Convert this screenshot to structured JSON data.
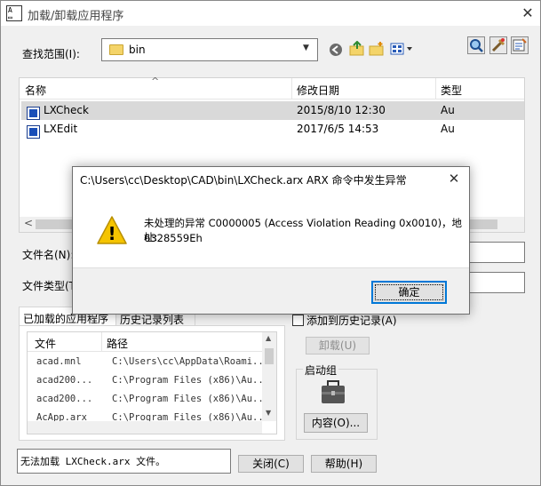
{
  "window": {
    "title": "加载/卸载应用程序",
    "app_icon_text": "A̲",
    "close_glyph": "✕"
  },
  "lookin": {
    "label": "查找范围(I):",
    "value": "bin"
  },
  "toolbar": {
    "right_icons": [
      "find-icon",
      "tools-icon",
      "options-icon"
    ]
  },
  "file_list": {
    "columns": [
      "名称",
      "修改日期",
      "类型"
    ],
    "sort_arrow": "^",
    "rows": [
      {
        "name": "LXCheck",
        "date": "2015/8/10 12:30",
        "type": "Au"
      },
      {
        "name": "LXEdit",
        "date": "2017/6/5 14:53",
        "type": "Au"
      }
    ],
    "hscroll_left": "<"
  },
  "filename": {
    "label": "文件名(N):"
  },
  "filetype": {
    "label": "文件类型(T)"
  },
  "tabs": {
    "loaded": "已加载的应用程序",
    "history": "历史记录列表"
  },
  "add_history": {
    "label": "添加到历史记录(A)"
  },
  "unload_button": "卸载(U)",
  "loaded_list": {
    "columns": [
      "文件",
      "路径"
    ],
    "rows": [
      {
        "file": "acad.mnl",
        "path": "C:\\Users\\cc\\AppData\\Roami..."
      },
      {
        "file": "acad200...",
        "path": "C:\\Program Files (x86)\\Au..."
      },
      {
        "file": "acad200...",
        "path": "C:\\Program Files (x86)\\Au..."
      },
      {
        "file": "AcApp.arx",
        "path": "C:\\Program Files (x86)\\Au..."
      }
    ]
  },
  "startup": {
    "label": "启动组",
    "contents_button": "内容(O)..."
  },
  "status": {
    "text": "无法加载 LXCheck.arx 文件。"
  },
  "bottom": {
    "close_button": "关闭(C)",
    "help_button": "帮助(H)"
  },
  "error_dialog": {
    "title": "C:\\Users\\cc\\Desktop\\CAD\\bin\\LXCheck.arx ARX 命令中发生异常",
    "close_glyph": "✕",
    "message_line1": "未处理的异常 C0000005 (Access Violation Reading 0x0010)，地址:",
    "message_line2": "6328559Eh",
    "ok_button": "确定",
    "warn_glyph": "!"
  },
  "colors": {
    "selection": "#d9d9d9",
    "accent": "#0078d7",
    "warning": "#f5c400"
  }
}
